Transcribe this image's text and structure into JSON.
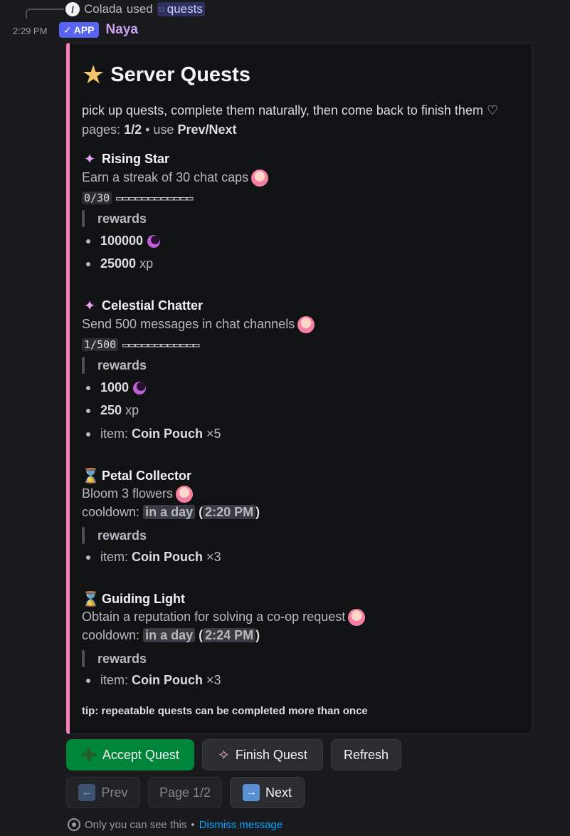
{
  "reply": {
    "user": "Colada",
    "used_text": "used",
    "command": "quests"
  },
  "message": {
    "timestamp": "2:29 PM",
    "badge": "APP",
    "author": "Naya"
  },
  "embed": {
    "accent_color": "#f47fbb",
    "title": "Server Quests",
    "description": "pick up quests, complete them naturally, then come back to finish them ♡",
    "pages_prefix": "pages:",
    "pages_value": "1/2",
    "pages_mid": "• use",
    "pages_nav": "Prev/Next",
    "rewards_label": "rewards",
    "quests": [
      {
        "name": "Rising Star",
        "icon": "feather-icon",
        "description": "Earn a streak of 30 chat caps",
        "progress": "0/30",
        "bar": "▭▭▭▭▭▭▭▭▭▭▭▭",
        "reward1_value": "100000",
        "reward2_value": "25000",
        "reward2_unit": "xp"
      },
      {
        "name": "Celestial Chatter",
        "icon": "feather-icon",
        "description": "Send 500 messages in chat channels",
        "progress": "1/500",
        "bar": "▭▭▭▭▭▭▭▭▭▭▭▭",
        "reward1_value": "1000",
        "reward2_value": "250",
        "reward2_unit": "xp",
        "reward3_prefix": "item:",
        "reward3_item": "Coin Pouch",
        "reward3_qty": "×5"
      },
      {
        "name": "Petal Collector",
        "icon": "hourglass-icon",
        "description": "Bloom 3 flowers",
        "cooldown_label": "cooldown:",
        "cooldown_rel": "in a day",
        "cooldown_time": "2:20 PM",
        "reward_prefix": "item:",
        "reward_item": "Coin Pouch",
        "reward_qty": "×3"
      },
      {
        "name": "Guiding Light",
        "icon": "hourglass-icon",
        "description": "Obtain a reputation for solving a co-op request",
        "cooldown_label": "cooldown:",
        "cooldown_rel": "in a day",
        "cooldown_time": "2:24 PM",
        "reward_prefix": "item:",
        "reward_item": "Coin Pouch",
        "reward_qty": "×3"
      }
    ],
    "tip": "tip: repeatable quests can be completed more than once"
  },
  "buttons": {
    "accept": "Accept Quest",
    "finish": "Finish Quest",
    "refresh": "Refresh",
    "prev": "Prev",
    "page": "Page 1/2",
    "next": "Next"
  },
  "footer": {
    "only_you": "Only you can see this",
    "separator": "•",
    "dismiss": "Dismiss message"
  }
}
